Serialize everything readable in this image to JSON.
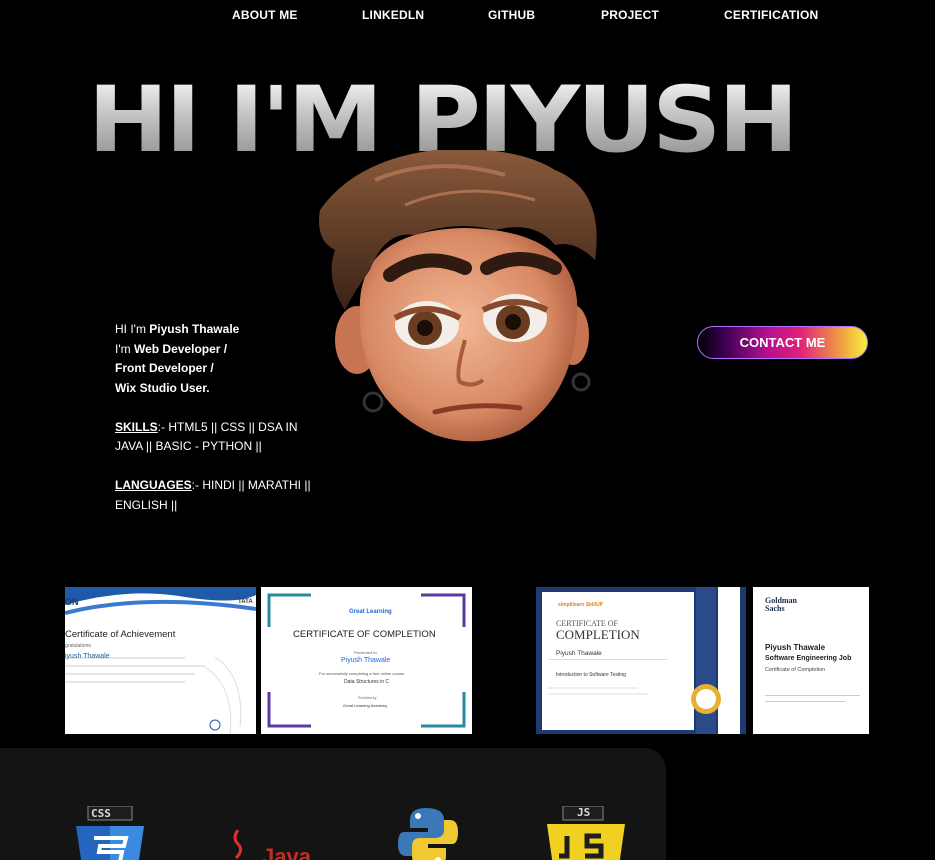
{
  "nav": {
    "items": [
      "ABOUT ME",
      "LINKEDLN",
      "GITHUB",
      "PROJECT",
      "CERTIFICATION"
    ]
  },
  "hero": {
    "title": "HI I'M PIYUSH"
  },
  "intro": {
    "line1_prefix": "HI I'm ",
    "name": "Piyush Thawale",
    "line2_prefix": "I'm ",
    "role1": "Web Developer /",
    "role2": "Front Developer /",
    "role3": "Wix Studio User.",
    "skills_label": "SKILLS",
    "skills_text": ":- HTML5 || CSS || DSA IN JAVA || BASIC - PYTHON ||",
    "languages_label": "LANGUAGES",
    "languages_text": ":- HINDI || MARATHI || ENGLISH ||"
  },
  "contact": {
    "label": "CONTACT ME"
  },
  "certificates": {
    "c1": {
      "brand_left": "ON",
      "brand_right": "TATA",
      "title": "Certificate of Achievement",
      "sub": "gratulations",
      "name": "iyush Thawale"
    },
    "c2": {
      "logo": "Great Learning",
      "title": "CERTIFICATE OF COMPLETION",
      "presented": "Presented to",
      "name": "Piyush Thawale",
      "for": "For successfully completing a free online course",
      "course": "Data Structures in C",
      "provided": "Provided by",
      "academy": "Great Learning Academy"
    },
    "c3": {
      "logo": "simplilearn SkillUP",
      "title_small": "CERTIFICATE OF",
      "title_big": "COMPLETION",
      "name": "Piyush Thawale",
      "course": "Introduction to Software Testing"
    },
    "c4": {
      "brand_line1": "Goldman",
      "brand_line2": "Sachs",
      "name": "Piyush Thawale",
      "job": "Software Engineering Job",
      "cert": "Certificate of Completion"
    }
  },
  "skills_logos": {
    "css": "CSS",
    "java": "Java",
    "js": "JS"
  }
}
